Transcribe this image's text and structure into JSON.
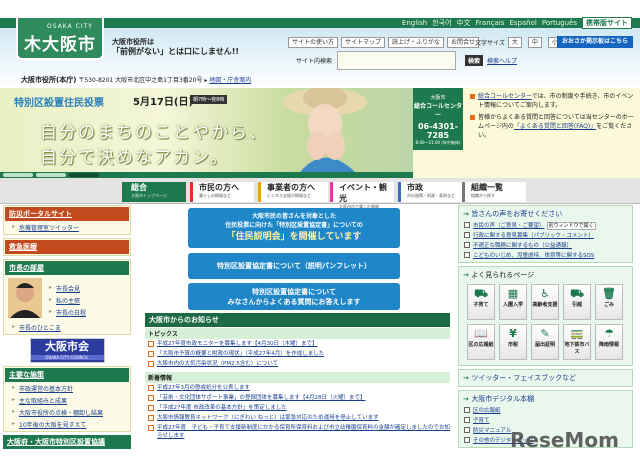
{
  "header": {
    "logo_en": "OSAKA CITY",
    "logo_jp": "大阪市",
    "tagline1": "大阪市役所は",
    "tagline2": "「前例がない」とは口にしません!!",
    "languages": [
      "English",
      "한국어",
      "中文",
      "Français",
      "Español",
      "Português"
    ],
    "mobile_site": "携帯版サイト",
    "tool_buttons": [
      "サイトの使い方",
      "サイトマップ",
      "読上げ・ふりがな",
      "お問合せ"
    ],
    "font_size_label": "文字サイズ",
    "font_sizes": [
      "大",
      "中",
      "小"
    ],
    "osaka_board": "おおさか掲示板はこちら",
    "search_label": "サイト内検索",
    "search_value": "",
    "search_button": "検索",
    "search_help": "検索ヘルプ",
    "address_name": "大阪市役所(本庁)",
    "address": "〒530-8201 大阪市北区中之島1丁目3番20号",
    "map_link": "地図・庁舎案内"
  },
  "banner": {
    "title": "特別区設置住民投票",
    "date": "5月17日(日)",
    "hours": "朝7時〜夜8時",
    "copy1": "自分のまちのことやから、",
    "copy2": "自分で決めなアカン。"
  },
  "call_center": {
    "city": "大阪市",
    "name": "総合コールセンター",
    "phone": "06-4301-7285",
    "hours": "8:00〜21:00 (年中無休)",
    "info1_link": "総合コールセンター",
    "info1": "では、市の制度や手続き、市のイベント情報についてご案内します。",
    "info2": "皆様からよくある質問と回答については当センターのホームページ内の",
    "info2_link": "「よくある質問と回答(FAQ)」",
    "info2_end": "をご覧ください。"
  },
  "nav": [
    {
      "label": "総合",
      "sub": "大阪市トップページ",
      "color": "#1e7a4e"
    },
    {
      "label": "市民の方へ",
      "sub": "暮らしの情報など",
      "color": "#d9362b"
    },
    {
      "label": "事業者の方へ",
      "sub": "ビジネス支援の情報など",
      "color": "#f0a01e"
    },
    {
      "label": "イベント・観光",
      "sub": "大阪市内で楽しむ情報",
      "color": "#d63fa0"
    },
    {
      "label": "市政",
      "sub": "市の施策・財政・条例など",
      "color": "#3a6fc0"
    },
    {
      "label": "組織一覧",
      "sub": "組織から探す",
      "color": "#777777"
    }
  ],
  "left": {
    "disaster_title": "防災ポータルサイト",
    "disaster_items": [
      "危機管理室ツイッター"
    ],
    "emergency_title": "救急医療",
    "mayor_title": "市長の部屋",
    "mayor_items": [
      "市長会見",
      "私の主張",
      "市長の日程"
    ],
    "mayor_more": "市長のひとこま",
    "council_jp": "大阪市会",
    "council_en": "OSAKA CITY COUNCIL",
    "policy_title": "主要な施策",
    "policy_items": [
      "市政運営の基本方針",
      "主な取組みと成果",
      "大阪市役所の点検・棚卸し結果",
      "10年後の大阪を見すえて"
    ],
    "bottom_title": "大阪府・大阪市特別区設置協議"
  },
  "center": {
    "box1_l1": "大阪市民の皆さんを対象とした",
    "box1_l2": "住民投票に向けた「特別区設置協定書」についての",
    "box1_l3": "「住民説明会」を開催しています",
    "box2": "特別区設置協定書について（説明パンフレット）",
    "box3_l1": "特別区設置協定書について",
    "box3_l2": "みなさんからよくある質問にお答えします",
    "news_title": "大阪市からのお知らせ",
    "topics_label": "トピックス",
    "topics": [
      "平成27年度市政モニターを募集します【4月30日（木曜）まで】",
      "「大阪市予算の概要と財政の現状」（平成27年4月）を作成しました",
      "大阪市内の大気汚染状況（PM2.5含む）について"
    ],
    "new_label": "新着情報",
    "new_items": [
      "平成27年3月の懲戒処分を公表します",
      "「芸術・文化団体サポート事業」の登録団体を募集します【4月28日（火曜）まで】",
      "「平成27年度 市政改革の基本方針」を策定しました",
      "大阪市情報教育ネットワーク（にぎわい ねっと）は緊急対応のため運用を停止しています",
      "平成27年度　子ども・子育て支援新制度にかかる保育所保育料および市立幼稚園保育料の金額が確定しましたのでお知らせします"
    ]
  },
  "right": {
    "voice_title": "皆さんの声をお寄せください",
    "voice_items": [
      "市民の声（ご意見・ご要望）",
      "行政に関する意見募集（パブリック・コメント）",
      "不適正な職務に関するもの（公益通報）",
      "こどものいじめ、児童虐待、体罰等に関するSOS"
    ],
    "new_window": "別ウィンドウで開く",
    "popular_title": "よく見られるページ",
    "tiles": [
      {
        "label": "子育て",
        "icon": "stroller-icon",
        "g": "⛟"
      },
      {
        "label": "入園入学",
        "icon": "school-icon",
        "g": "▦"
      },
      {
        "label": "高齢者支援",
        "icon": "elderly-icon",
        "g": "♿"
      },
      {
        "label": "引越",
        "icon": "truck-icon",
        "g": "⛟"
      },
      {
        "label": "ごみ",
        "icon": "trash-icon",
        "g": "🗑"
      },
      {
        "label": "区の広報紙",
        "icon": "book-icon",
        "g": "📖"
      },
      {
        "label": "市税",
        "icon": "yen-icon",
        "g": "¥"
      },
      {
        "label": "届出証明",
        "icon": "form-icon",
        "g": "✎"
      },
      {
        "label": "地下鉄市バス",
        "icon": "train-icon",
        "g": "🚃"
      },
      {
        "label": "降雨情報",
        "icon": "umbrella-icon",
        "g": "☂"
      }
    ],
    "social_title": "ツイッター・フェイスブックなど",
    "digital_title": "大阪市デジタル本棚",
    "digital_items": [
      "区の広報紙",
      "子育て",
      "防災マニュアル",
      "その他のデジタルブック"
    ]
  },
  "watermark": "ReseMom"
}
